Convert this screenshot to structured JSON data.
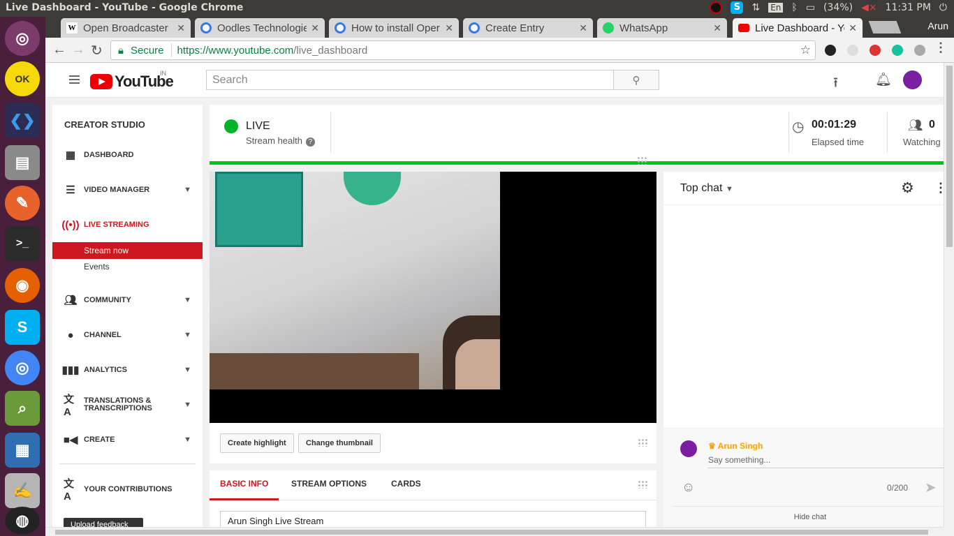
{
  "os": {
    "window_title": "Live Dashboard - YouTube - Google Chrome",
    "keyboard": "En",
    "battery": "(34%)",
    "clock": "11:31 PM"
  },
  "browser": {
    "tabs": [
      {
        "label": "Open Broadcaster",
        "favicon": "W"
      },
      {
        "label": "Oodles Technologie",
        "favicon": "o"
      },
      {
        "label": "How to install Oper",
        "favicon": "o"
      },
      {
        "label": "Create Entry",
        "favicon": "o"
      },
      {
        "label": "WhatsApp",
        "favicon": "w"
      },
      {
        "label": "Live Dashboard - Yo",
        "favicon": "yt"
      }
    ],
    "profile": "Arun",
    "security_label": "Secure",
    "url_scheme_host": "https://www.youtube.com",
    "url_path": "/live_dashboard"
  },
  "youtube": {
    "logo_text": "YouTube",
    "region": "IN",
    "search_placeholder": "Search"
  },
  "sidebar": {
    "heading": "CREATOR STUDIO",
    "items": [
      {
        "label": "DASHBOARD"
      },
      {
        "label": "VIDEO MANAGER"
      },
      {
        "label": "LIVE STREAMING"
      },
      {
        "label": "COMMUNITY"
      },
      {
        "label": "CHANNEL"
      },
      {
        "label": "ANALYTICS"
      },
      {
        "label": "TRANSLATIONS &"
      },
      {
        "label": "CREATE"
      },
      {
        "label": "YOUR CONTRIBUTIONS"
      }
    ],
    "translations_line2": "TRANSCRIPTIONS",
    "sub_items": [
      "Stream now",
      "Events"
    ],
    "feedback_button": "Upload feedback"
  },
  "stream": {
    "status": "LIVE",
    "health_label": "Stream health",
    "elapsed_value": "00:01:29",
    "elapsed_label": "Elapsed time",
    "watching_value": "0",
    "watching_label": "Watching",
    "status_color": "#00b42a"
  },
  "video_controls": {
    "highlight_button": "Create highlight",
    "thumbnail_button": "Change thumbnail"
  },
  "info": {
    "tabs": [
      "BASIC INFO",
      "STREAM OPTIONS",
      "CARDS"
    ],
    "title_value": "Arun Singh Live Stream"
  },
  "chat": {
    "mode": "Top chat",
    "user_name": "Arun Singh",
    "input_placeholder": "Say something...",
    "char_count": "0/200",
    "hide_label": "Hide chat"
  }
}
